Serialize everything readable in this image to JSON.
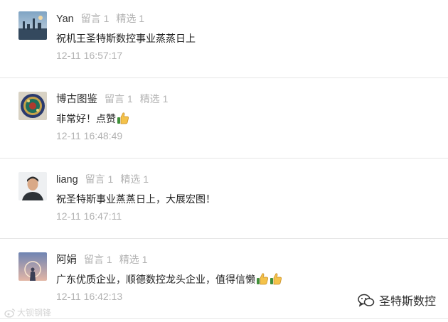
{
  "comments": [
    {
      "nickname": "Yan",
      "messages": "留言 1",
      "selected": "精选 1",
      "text": "祝机王圣特斯数控事业蒸蒸日上",
      "time": "12-11 16:57:17",
      "thumbs": 0
    },
    {
      "nickname": "博古图鉴",
      "messages": "留言 1",
      "selected": "精选 1",
      "text": "非常好！点赞",
      "time": "12-11 16:48:49",
      "thumbs": 1
    },
    {
      "nickname": "liang",
      "messages": "留言 1",
      "selected": "精选 1",
      "text": "祝圣特斯事业蒸蒸日上，大展宏图！",
      "time": "12-11 16:47:11",
      "thumbs": 0
    },
    {
      "nickname": "阿娟",
      "messages": "留言 1",
      "selected": "精选 1",
      "text": "广东优质企业，顺德数控龙头企业，值得信懒",
      "time": "12-11 16:42:13",
      "thumbs": 2
    }
  ],
  "watermark_left": "大钡钢锋",
  "watermark_right": "圣特斯数控",
  "colors": {
    "nickname": "#333333",
    "meta": "#b2b2b2",
    "text": "#222222",
    "divider": "#e6e6e6"
  },
  "icons": {
    "thumb": "thumbs-up-icon",
    "wechat": "wechat-icon"
  }
}
